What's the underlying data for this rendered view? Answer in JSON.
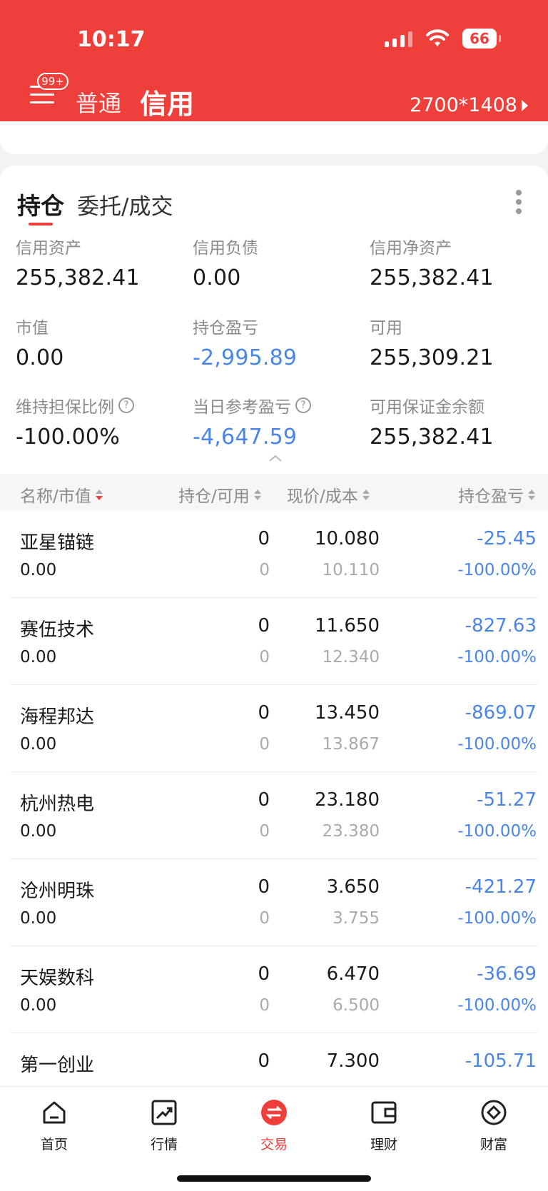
{
  "status_bar": {
    "time": "10:17",
    "battery": "66"
  },
  "header": {
    "msg_badge": "99+",
    "tab_normal": "普通",
    "tab_credit": "信用",
    "account": "2700*1408"
  },
  "tabs": {
    "holdings": "持仓",
    "orders": "委托/成交"
  },
  "summary": [
    {
      "label": "信用资产",
      "value": "255,382.41",
      "blue": false,
      "help": false
    },
    {
      "label": "信用负债",
      "value": "0.00",
      "blue": false,
      "help": false
    },
    {
      "label": "信用净资产",
      "value": "255,382.41",
      "blue": false,
      "help": false
    },
    {
      "label": "市值",
      "value": "0.00",
      "blue": false,
      "help": false
    },
    {
      "label": "持仓盈亏",
      "value": "-2,995.89",
      "blue": true,
      "help": false
    },
    {
      "label": "可用",
      "value": "255,309.21",
      "blue": false,
      "help": false
    },
    {
      "label": "维持担保比例",
      "value": "-100.00%",
      "blue": false,
      "help": true
    },
    {
      "label": "当日参考盈亏",
      "value": "-4,647.59",
      "blue": true,
      "help": true
    },
    {
      "label": "可用保证金余额",
      "value": "255,382.41",
      "blue": false,
      "help": false
    }
  ],
  "table": {
    "headers": {
      "name": "名称/市值",
      "position": "持仓/可用",
      "price": "现价/成本",
      "pnl": "持仓盈亏"
    },
    "rows": [
      {
        "name": "亚星锚链",
        "market_value": "0.00",
        "position": "0",
        "available": "0",
        "price": "10.080",
        "cost": "10.110",
        "pnl": "-25.45",
        "pnl_pct": "-100.00%"
      },
      {
        "name": "赛伍技术",
        "market_value": "0.00",
        "position": "0",
        "available": "0",
        "price": "11.650",
        "cost": "12.340",
        "pnl": "-827.63",
        "pnl_pct": "-100.00%"
      },
      {
        "name": "海程邦达",
        "market_value": "0.00",
        "position": "0",
        "available": "0",
        "price": "13.450",
        "cost": "13.867",
        "pnl": "-869.07",
        "pnl_pct": "-100.00%"
      },
      {
        "name": "杭州热电",
        "market_value": "0.00",
        "position": "0",
        "available": "0",
        "price": "23.180",
        "cost": "23.380",
        "pnl": "-51.27",
        "pnl_pct": "-100.00%"
      },
      {
        "name": "沧州明珠",
        "market_value": "0.00",
        "position": "0",
        "available": "0",
        "price": "3.650",
        "cost": "3.755",
        "pnl": "-421.27",
        "pnl_pct": "-100.00%"
      },
      {
        "name": "天娱数科",
        "market_value": "0.00",
        "position": "0",
        "available": "0",
        "price": "6.470",
        "cost": "6.500",
        "pnl": "-36.69",
        "pnl_pct": "-100.00%"
      },
      {
        "name": "第一创业",
        "market_value": "",
        "position": "0",
        "available": "",
        "price": "7.300",
        "cost": "",
        "pnl": "-105.71",
        "pnl_pct": ""
      }
    ]
  },
  "bottom_nav": [
    {
      "label": "首页",
      "icon": "home-icon",
      "active": false
    },
    {
      "label": "行情",
      "icon": "chart-icon",
      "active": false
    },
    {
      "label": "交易",
      "icon": "trade-icon",
      "active": true
    },
    {
      "label": "理财",
      "icon": "wallet-icon",
      "active": false
    },
    {
      "label": "财富",
      "icon": "wealth-icon",
      "active": false
    }
  ],
  "colors": {
    "brand_red": "#ee3f3a",
    "loss_blue": "#4a86e8"
  }
}
